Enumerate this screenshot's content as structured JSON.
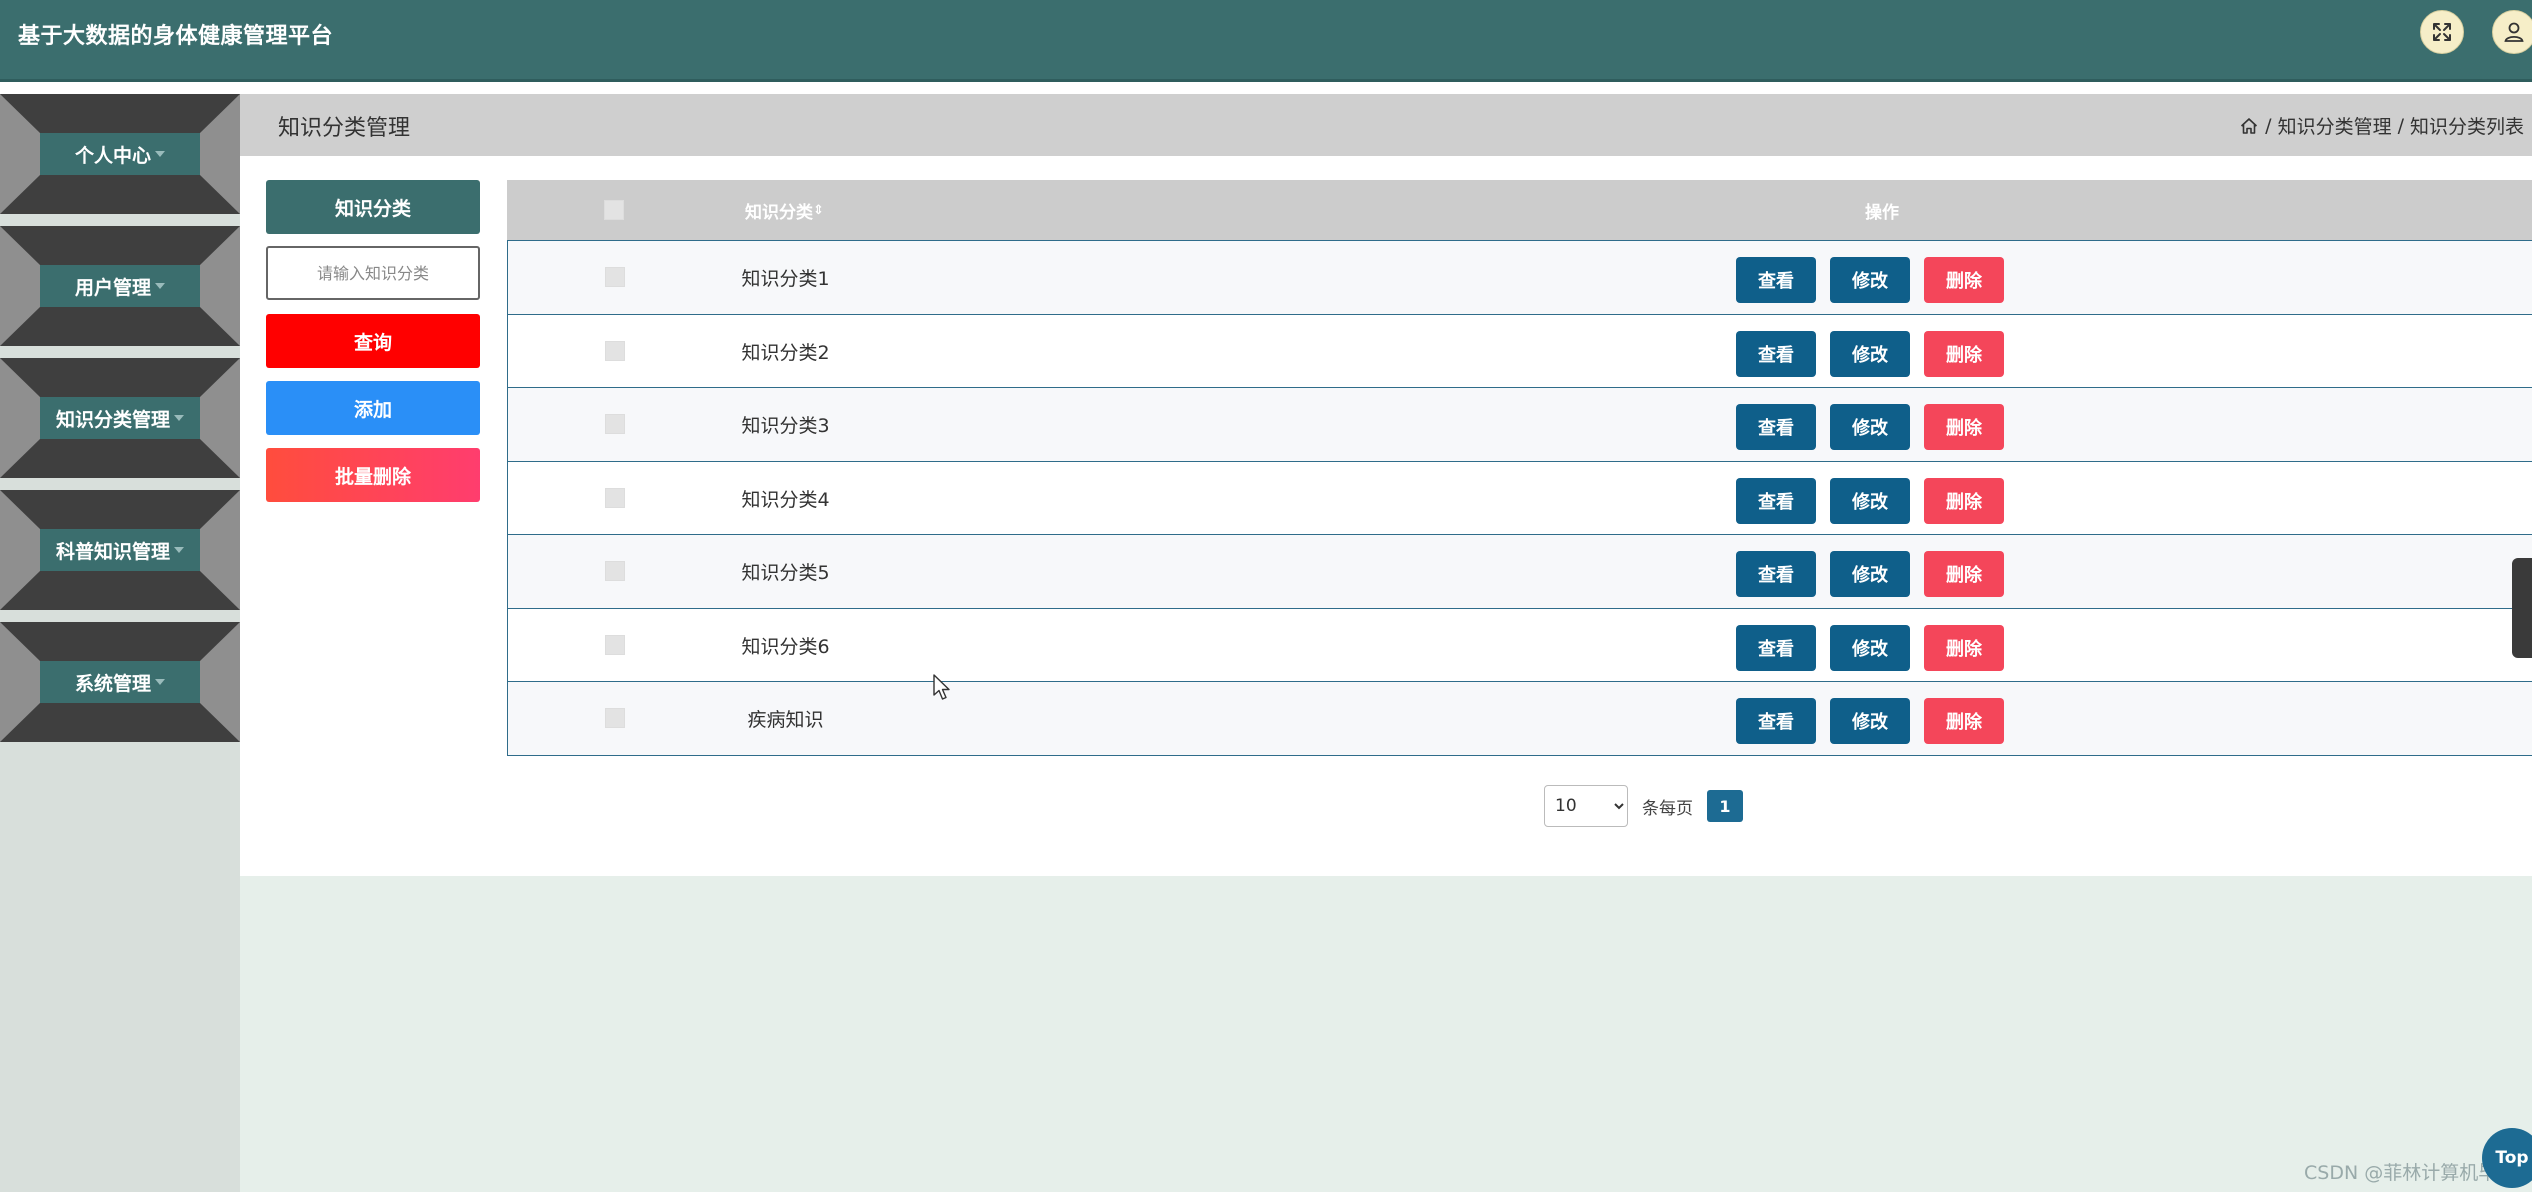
{
  "header": {
    "title": "基于大数据的身体健康管理平台"
  },
  "sidebar": {
    "items": [
      {
        "label": "个人中心"
      },
      {
        "label": "用户管理"
      },
      {
        "label": "知识分类管理"
      },
      {
        "label": "科普知识管理"
      },
      {
        "label": "系统管理"
      }
    ]
  },
  "breadcrumb": {
    "page_title": "知识分类管理",
    "path": [
      "知识分类管理",
      "知识分类列表"
    ],
    "separator": "/"
  },
  "actions": {
    "category_label": "知识分类",
    "search_placeholder": "请输入知识分类",
    "search_value": "",
    "query_label": "查询",
    "add_label": "添加",
    "batch_delete_label": "批量删除"
  },
  "table": {
    "columns": [
      "知识分类",
      "操作"
    ],
    "sort_indicator": "⇕",
    "rows": [
      {
        "name": "知识分类1"
      },
      {
        "name": "知识分类2"
      },
      {
        "name": "知识分类3"
      },
      {
        "name": "知识分类4"
      },
      {
        "name": "知识分类5"
      },
      {
        "name": "知识分类6"
      },
      {
        "name": "疾病知识"
      }
    ],
    "row_actions": {
      "view": "查看",
      "edit": "修改",
      "delete": "删除"
    }
  },
  "pagination": {
    "page_size": "10",
    "page_size_options": [
      "10"
    ],
    "per_page_label": "条每页",
    "current_page": "1"
  },
  "back_to_top": "Top",
  "watermark": "CSDN @菲林计算机毕设",
  "colors": {
    "header_bg": "#3b6e6e",
    "query_btn": "#ff0000",
    "add_btn": "#2a8ff7",
    "batch_delete_btn": "#ff4d4f",
    "view_edit_btn": "#0f5f8a",
    "delete_btn": "#f4465a",
    "main_bottom_bg": "#e6efea"
  },
  "icons": [
    "fullscreen-icon",
    "user-icon",
    "home-icon",
    "caret-down-icon",
    "sort-icon",
    "chevron-down-icon"
  ]
}
